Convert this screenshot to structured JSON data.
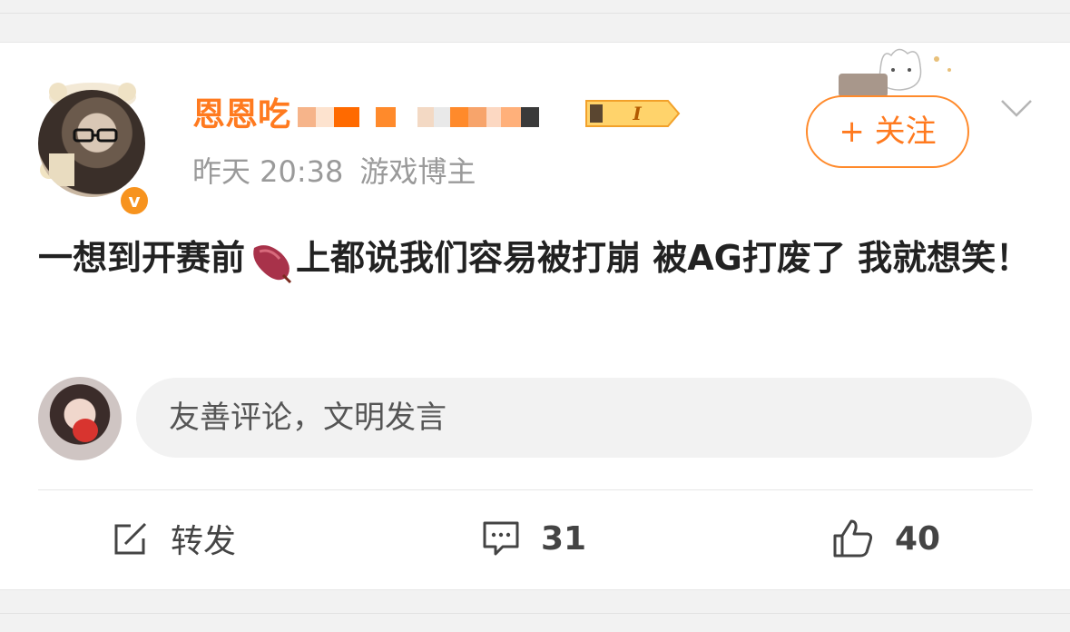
{
  "post": {
    "username": "恩恩吃",
    "level_badge": "I",
    "time": "昨天 20:38",
    "tag": "游戏博主",
    "follow_label": "+ 关注",
    "text_before": "一想到开赛前",
    "text_after": "上都说我们容易被打崩 被AG打废了 我就想笑！",
    "emoji_name": "sweet-potato-emoji"
  },
  "comment_box": {
    "placeholder": "友善评论，文明发言"
  },
  "actions": {
    "repost_label": "转发",
    "comment_count": "31",
    "like_count": "40"
  },
  "colors": {
    "accent": "#ff7a1f",
    "verified_badge": "#f7931e",
    "background": "#f2f2f2"
  },
  "icons": [
    "chevron-down-icon",
    "edit-icon",
    "comment-icon",
    "thumbs-up-icon",
    "verified-v-icon"
  ]
}
